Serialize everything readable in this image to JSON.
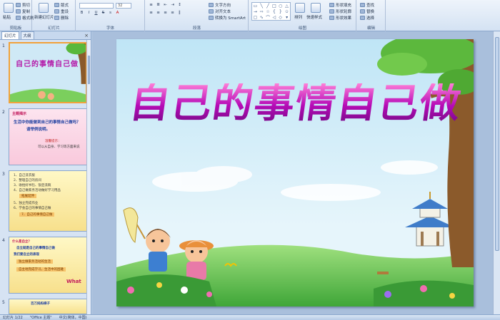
{
  "ribbon": {
    "groups": [
      {
        "label": "剪贴板",
        "buttons": [
          "粘贴",
          "剪切",
          "复制",
          "格式刷"
        ]
      },
      {
        "label": "幻灯片",
        "buttons": [
          "新建幻灯片",
          "版式",
          "重设",
          "删除"
        ]
      },
      {
        "label": "字体",
        "font_size": "32"
      },
      {
        "label": "段落",
        "buttons": [
          "文字方向",
          "对齐文本",
          "转换为 SmartArt"
        ]
      },
      {
        "label": "绘图",
        "buttons": [
          "排列",
          "快速样式",
          "形状填充",
          "形状轮廓",
          "形状效果"
        ]
      },
      {
        "label": "编辑",
        "buttons": [
          "查找",
          "替换",
          "选择"
        ]
      }
    ]
  },
  "panel": {
    "tabs": [
      "幻灯片",
      "大纲"
    ],
    "close": "×",
    "thumbs": [
      {
        "num": "1",
        "title": "自己的事情自己做"
      },
      {
        "num": "2",
        "heading": "主题揭示",
        "lines": [
          "生活中你能做到自己的事情自己做吗？",
          "请举例说明。",
          "温馨提示：",
          "可以从自身、学习等方面来说"
        ]
      },
      {
        "num": "3",
        "lines": [
          "1、自己洗衣服",
          "2、整理自己的房间",
          "3、收拾好书包、饭后洗碗",
          "4、自己做家务活动做好学习用品",
          "拓展延伸",
          "5、独立完成作业",
          "6、学会自己的事情自己做",
          "7、自己的事情自己做"
        ]
      },
      {
        "num": "4",
        "lines": [
          "什么是自立？",
          "自立就是自己的事情自己做",
          "我们要自立的表现",
          "独立做家务活动的生活",
          "自主地完成学习，生活中的困难",
          "What"
        ]
      },
      {
        "num": "5",
        "lines": [
          "百万妈妈梯子"
        ]
      }
    ]
  },
  "slide": {
    "title_chars": [
      "自",
      "己",
      "的",
      "事",
      "情",
      "自",
      "己",
      "做"
    ]
  },
  "status": {
    "slide_info": "幻灯片 1/22",
    "theme": "\"Office 主题\"",
    "language": "中文(简体，中国)"
  },
  "colors": {
    "title_gradient_top": "#ff7fd8",
    "title_gradient_bottom": "#7a0a8a",
    "ribbon": "#d4e2f3",
    "selection": "#f2a23a"
  }
}
